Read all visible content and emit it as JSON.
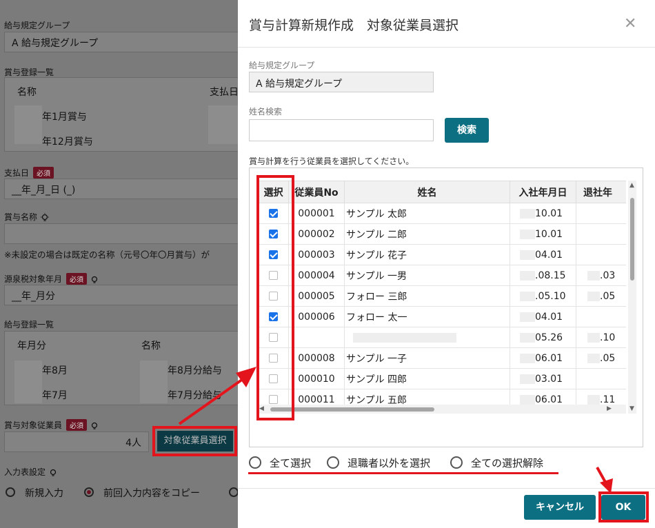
{
  "background": {
    "salary_group_label": "給与規定グループ",
    "salary_group_value": "A 給与規定グループ",
    "bonus_list_label": "賞与登録一覧",
    "bonus_col_name": "名称",
    "bonus_col_pay": "支払日",
    "bonus_rows": [
      "年1月賞与",
      "年12月賞与"
    ],
    "pay_date_label": "支払日",
    "required": "必須",
    "pay_date_value": "__年_月_日 (_)",
    "bonus_name_label": "賞与名称",
    "bonus_name_note": "※未設定の場合は既定の名称（元号〇年〇月賞与）が",
    "tax_year_label": "源泉税対象年月",
    "tax_year_value": "__年_月分",
    "salary_list_label": "給与登録一覧",
    "salary_col_month": "年月分",
    "salary_col_name": "名称",
    "salary_rows": [
      {
        "month": "年8月",
        "name": "年8月分給与"
      },
      {
        "month": "年7月",
        "name": "年7月分給与"
      }
    ],
    "target_label": "賞与対象従業員",
    "target_count": "4人",
    "target_button": "対象従業員選択",
    "input_setting_label": "入力表設定",
    "radio_new": "新規入力",
    "radio_copy": "前回入力内容をコピー"
  },
  "modal": {
    "title": "賞与計算新規作成　対象従業員選択",
    "group_label": "給与規定グループ",
    "group_value": "A 給与規定グループ",
    "name_search_label": "姓名検索",
    "name_search_value": "",
    "search_button": "検索",
    "instruction": "賞与計算を行う従業員を選択してください。",
    "table": {
      "headers": [
        "選択",
        "従業員No",
        "姓名",
        "入社年月日",
        "退社年"
      ],
      "rows": [
        {
          "checked": true,
          "no": "000001",
          "name": "サンプル 太郎",
          "hire": "10.01",
          "leave": ""
        },
        {
          "checked": true,
          "no": "000002",
          "name": "サンプル 二郎",
          "hire": "10.01",
          "leave": ""
        },
        {
          "checked": true,
          "no": "000003",
          "name": "サンプル 花子",
          "hire": "04.01",
          "leave": ""
        },
        {
          "checked": false,
          "no": "000004",
          "name": "サンプル 一男",
          "hire": ".08.15",
          "leave": ".03"
        },
        {
          "checked": false,
          "no": "000005",
          "name": "フォロー 三郎",
          "hire": ".05.10",
          "leave": ".05"
        },
        {
          "checked": true,
          "no": "000006",
          "name": "フォロー 太一",
          "hire": "04.01",
          "leave": ""
        },
        {
          "checked": false,
          "no": "",
          "name": "",
          "hire": "05.26",
          "leave": ".10"
        },
        {
          "checked": false,
          "no": "000008",
          "name": "サンプル 一子",
          "hire": "06.01",
          "leave": ".05"
        },
        {
          "checked": false,
          "no": "000010",
          "name": "サンプル 四郎",
          "hire": "03.01",
          "leave": ""
        },
        {
          "checked": false,
          "no": "000011",
          "name": "サンプル 五郎",
          "hire": "06.01",
          "leave": ".11"
        },
        {
          "checked": false,
          "no": "",
          "name": "",
          "hire": "",
          "leave": ""
        }
      ]
    },
    "options": [
      "全て選択",
      "退職者以外を選択",
      "全ての選択解除"
    ],
    "cancel_button": "キャンセル",
    "ok_button": "OK"
  },
  "colors": {
    "accent": "#0d6f82",
    "annotation": "#e3141c",
    "required_badge": "#6b1322",
    "checkbox": "#1a73e8"
  }
}
